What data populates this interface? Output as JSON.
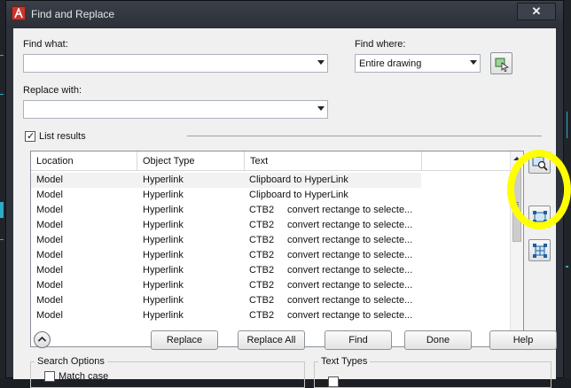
{
  "window": {
    "title": "Find and Replace",
    "close_label": "✕"
  },
  "find": {
    "label": "Find what:",
    "value": ""
  },
  "replace": {
    "label": "Replace with:",
    "value": ""
  },
  "find_where": {
    "label": "Find where:",
    "value": "Entire drawing"
  },
  "list_results": {
    "label": "List results",
    "checked": true
  },
  "results": {
    "columns": [
      "Location",
      "Object Type",
      "Text"
    ],
    "rows": [
      {
        "location": "Model",
        "type": "Hyperlink",
        "text1": "Clipboard to HyperLink",
        "text2": ""
      },
      {
        "location": "Model",
        "type": "Hyperlink",
        "text1": "Clipboard to HyperLink",
        "text2": ""
      },
      {
        "location": "Model",
        "type": "Hyperlink",
        "text1": "CTB2",
        "text2": "convert rectange to selecte..."
      },
      {
        "location": "Model",
        "type": "Hyperlink",
        "text1": "CTB2",
        "text2": "convert rectange to selecte..."
      },
      {
        "location": "Model",
        "type": "Hyperlink",
        "text1": "CTB2",
        "text2": "convert rectange to selecte..."
      },
      {
        "location": "Model",
        "type": "Hyperlink",
        "text1": "CTB2",
        "text2": "convert rectange to selecte..."
      },
      {
        "location": "Model",
        "type": "Hyperlink",
        "text1": "CTB2",
        "text2": "convert rectange to selecte..."
      },
      {
        "location": "Model",
        "type": "Hyperlink",
        "text1": "CTB2",
        "text2": "convert rectange to selecte..."
      },
      {
        "location": "Model",
        "type": "Hyperlink",
        "text1": "CTB2",
        "text2": "convert rectange to selecte..."
      },
      {
        "location": "Model",
        "type": "Hyperlink",
        "text1": "CTB2",
        "text2": "convert rectange to selecte..."
      }
    ]
  },
  "buttons": {
    "replace": "Replace",
    "replace_all": "Replace All",
    "find": "Find",
    "done": "Done",
    "help": "Help"
  },
  "groups": {
    "search_options": "Search Options",
    "match_case": "Match case",
    "text_types": "Text Types"
  },
  "icons": {
    "select_objects": "select-objects-icon",
    "zoom_to_selected": "zoom-to-selected-icon",
    "create_selection_set": "create-selection-set-icon",
    "create_selection_set_all": "create-selection-set-all-icon",
    "more_options": "chevron-up-icon"
  },
  "colors": {
    "annotation_highlight": "#ffff00"
  }
}
